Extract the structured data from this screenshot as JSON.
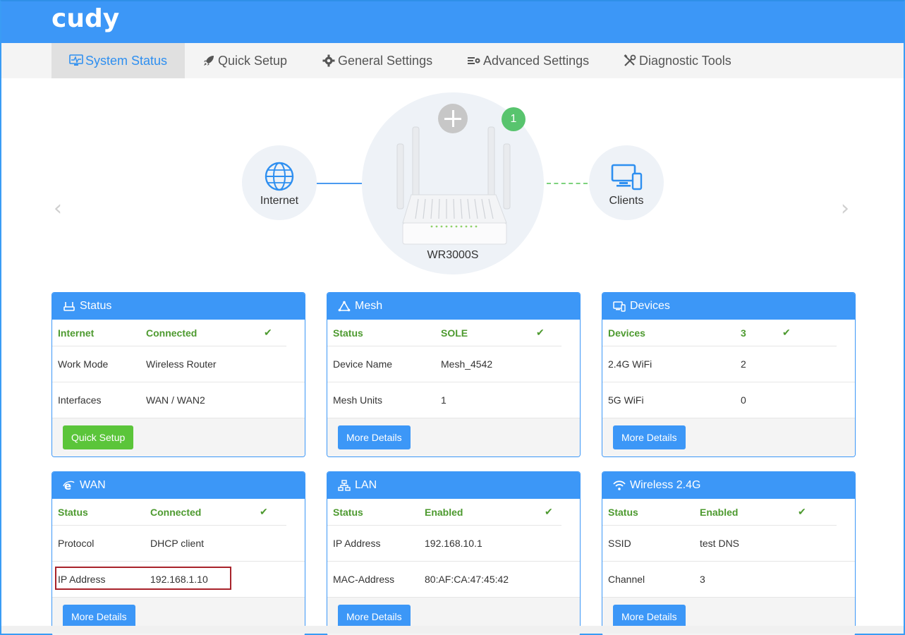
{
  "header": {
    "logo": "cudy",
    "colors": {
      "primary": "#3c97f7",
      "success": "#5bc53a"
    }
  },
  "nav": {
    "items": [
      {
        "label": "System Status",
        "icon": "monitor-icon",
        "active": true
      },
      {
        "label": "Quick Setup",
        "icon": "rocket-icon"
      },
      {
        "label": "General Settings",
        "icon": "gear-icon"
      },
      {
        "label": "Advanced Settings",
        "icon": "advanced-settings-icon"
      },
      {
        "label": "Diagnostic Tools",
        "icon": "tools-icon"
      }
    ]
  },
  "topology": {
    "internet_label": "Internet",
    "router_label": "WR3000S",
    "clients_label": "Clients",
    "mesh_badge": "1"
  },
  "cards": {
    "status": {
      "title": "Status",
      "rows": [
        {
          "k": "Internet",
          "v": "Connected"
        },
        {
          "k": "Work Mode",
          "v": "Wireless Router"
        },
        {
          "k": "Interfaces",
          "v": "WAN / WAN2"
        }
      ],
      "button": "Quick Setup"
    },
    "mesh": {
      "title": "Mesh",
      "rows": [
        {
          "k": "Status",
          "v": "SOLE"
        },
        {
          "k": "Device Name",
          "v": "Mesh_4542"
        },
        {
          "k": "Mesh Units",
          "v": "1"
        }
      ],
      "button": "More Details"
    },
    "devices": {
      "title": "Devices",
      "rows": [
        {
          "k": "Devices",
          "v": "3"
        },
        {
          "k": "2.4G WiFi",
          "v": "2"
        },
        {
          "k": "5G WiFi",
          "v": "0"
        }
      ],
      "button": "More Details"
    },
    "wan": {
      "title": "WAN",
      "rows": [
        {
          "k": "Status",
          "v": "Connected"
        },
        {
          "k": "Protocol",
          "v": "DHCP client"
        },
        {
          "k": "IP Address",
          "v": "192.168.1.10"
        }
      ],
      "button": "More Details"
    },
    "lan": {
      "title": "LAN",
      "rows": [
        {
          "k": "Status",
          "v": "Enabled"
        },
        {
          "k": "IP Address",
          "v": "192.168.10.1"
        },
        {
          "k": "MAC-Address",
          "v": "80:AF:CA:47:45:42"
        }
      ],
      "button": "More Details"
    },
    "wireless24": {
      "title": "Wireless 2.4G",
      "rows": [
        {
          "k": "Status",
          "v": "Enabled"
        },
        {
          "k": "SSID",
          "v": "test DNS"
        },
        {
          "k": "Channel",
          "v": "3"
        }
      ],
      "button": "More Details"
    }
  }
}
